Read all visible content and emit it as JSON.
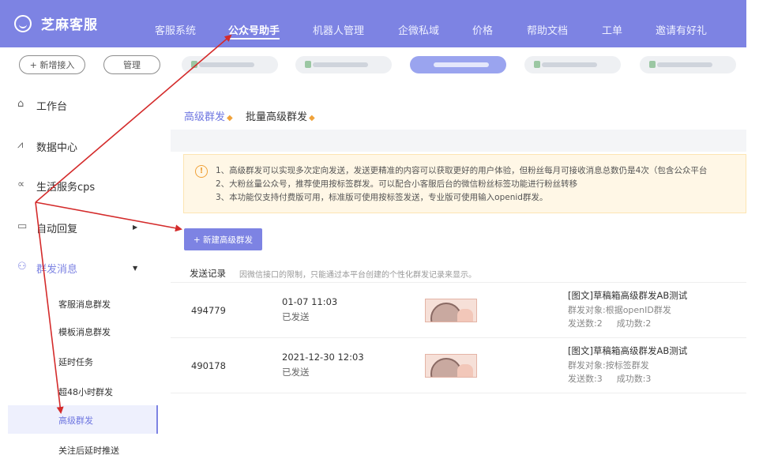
{
  "brand": {
    "name": "芝麻客服",
    "logo_icon": "smile-circle-icon"
  },
  "topnav": {
    "items": [
      {
        "label": "客服系统"
      },
      {
        "label": "公众号助手"
      },
      {
        "label": "机器人管理"
      },
      {
        "label": "企微私域"
      },
      {
        "label": "价格"
      },
      {
        "label": "帮助文档"
      },
      {
        "label": "工单"
      },
      {
        "label": "邀请有好礼"
      }
    ],
    "active_index": 1
  },
  "account_bar": {
    "add_label": "+ 新增接入",
    "manage_label": "管理",
    "accounts_blurred": 5,
    "active_account_index": 2
  },
  "sidebar": {
    "items": [
      {
        "label": "工作台",
        "icon": "home-icon"
      },
      {
        "label": "数据中心",
        "icon": "line-chart-icon"
      },
      {
        "label": "生活服务cps",
        "icon": "share-icon"
      },
      {
        "label": "自动回复",
        "icon": "message-icon"
      },
      {
        "label": "群发消息",
        "icon": "users-icon"
      }
    ],
    "sub_items": [
      {
        "label": "客服消息群发"
      },
      {
        "label": "模板消息群发"
      },
      {
        "label": "延时任务"
      },
      {
        "label": "超48小时群发"
      },
      {
        "label": "高级群发"
      },
      {
        "label": "关注后延时推送"
      }
    ],
    "active_sub_index": 4
  },
  "main": {
    "tabs": [
      {
        "label": "高级群发"
      },
      {
        "label": "批量高级群发"
      }
    ],
    "active_tab_index": 0,
    "notice": {
      "lines": [
        "1、高级群发可以实现多次定向发送，发送更精准的内容可以获取更好的用户体验，但粉丝每月可接收消息总数仍是4次（包含公众平台",
        "2、大粉丝量公众号，推荐使用按标签群发。可以配合小客服后台的微信粉丝标签功能进行粉丝转移",
        "3、本功能仅支持付费版可用，标准版可使用按标签发送，专业版可使用输入openid群发。"
      ]
    },
    "new_button_label": "+ 新建高级群发",
    "records": {
      "title": "发送记录",
      "tip": "因微信接口的限制，只能通过本平台创建的个性化群发记录来显示。",
      "rows": [
        {
          "id": "494779",
          "time": "01-07 11:03",
          "status": "已发送",
          "article": "[图文]草稿箱高级群发AB测试",
          "target": "群发对象:根据openID群发",
          "sent": "发送数:2",
          "success": "成功数:2"
        },
        {
          "id": "490178",
          "time": "2021-12-30 12:03",
          "status": "已发送",
          "article": "[图文]草稿箱高级群发AB测试",
          "target": "群发对象:按标签群发",
          "sent": "发送数:3",
          "success": "成功数:3"
        }
      ]
    }
  },
  "colors": {
    "accent": "#7d83e3",
    "annotation_arrow": "#d42b2b",
    "notice_bg": "#fff7e6"
  }
}
